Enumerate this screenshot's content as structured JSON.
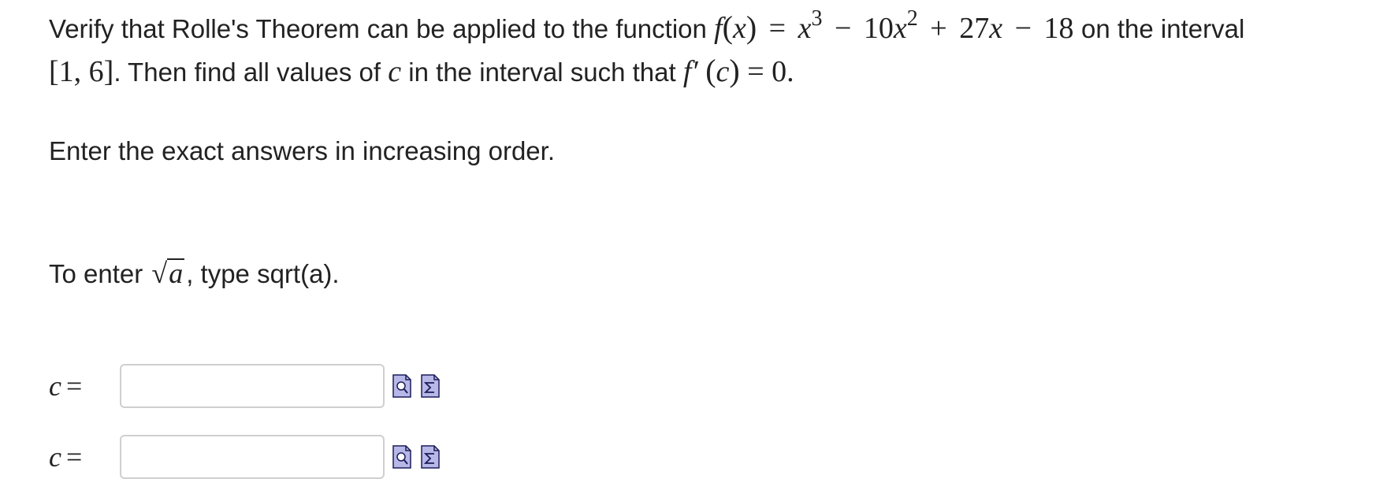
{
  "problem": {
    "text_before_fx": "Verify that Rolle's Theorem can be applied to the function",
    "function_lhs": "f",
    "function_arg": "x",
    "equals": "=",
    "term1_base": "x",
    "term1_exp": "3",
    "minus1": "−",
    "term2_coef": "10",
    "term2_base": "x",
    "term2_exp": "2",
    "plus1": "+",
    "term3_coef": "27",
    "term3_base": "x",
    "minus2": "−",
    "term4": "18",
    "text_after_fx": "on the interval",
    "interval": "[1, 6]",
    "text_then": ". Then find all values of",
    "var_c": "c",
    "text_such_that": "in the interval such that",
    "deriv_lhs": "f′",
    "deriv_arg": "c",
    "deriv_rhs": "= 0."
  },
  "instructions": {
    "order": "Enter the exact answers in increasing order.",
    "sqrt_prefix": "To enter",
    "sqrt_var": "a",
    "sqrt_suffix": ", type sqrt(a)."
  },
  "answers": [
    {
      "label_var": "c",
      "label_eq": "=",
      "value": ""
    },
    {
      "label_var": "c",
      "label_eq": "=",
      "value": ""
    }
  ],
  "icons": {
    "preview": "preview-icon",
    "equation_editor": "equation-editor-icon"
  },
  "colors": {
    "text": "#222222",
    "input_border": "#cfcfcf",
    "icon_fill": "#b8b8e8",
    "icon_stroke": "#1c1c5a"
  }
}
